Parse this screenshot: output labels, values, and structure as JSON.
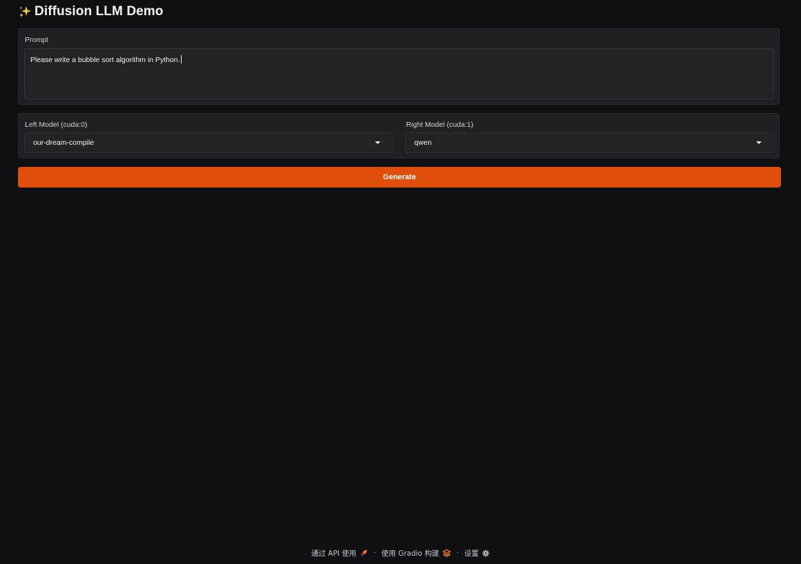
{
  "app": {
    "title": "Diffusion LLM Demo",
    "title_icon": "sparkles-icon"
  },
  "prompt": {
    "label": "Prompt",
    "value": "Please write a bubble sort algorithm in Python."
  },
  "models": {
    "left": {
      "label": "Left Model (cuda:0)",
      "selected": "our-dream-compile"
    },
    "right": {
      "label": "Right Model (cuda:1)",
      "selected": "qwen"
    }
  },
  "generate_button": {
    "label": "Generate",
    "color": "#e04e0b"
  },
  "footer": {
    "api_label": "通过 API 使用",
    "built_with_label": "使用 Gradio 构建",
    "settings_label": "设置",
    "separator": "·"
  }
}
